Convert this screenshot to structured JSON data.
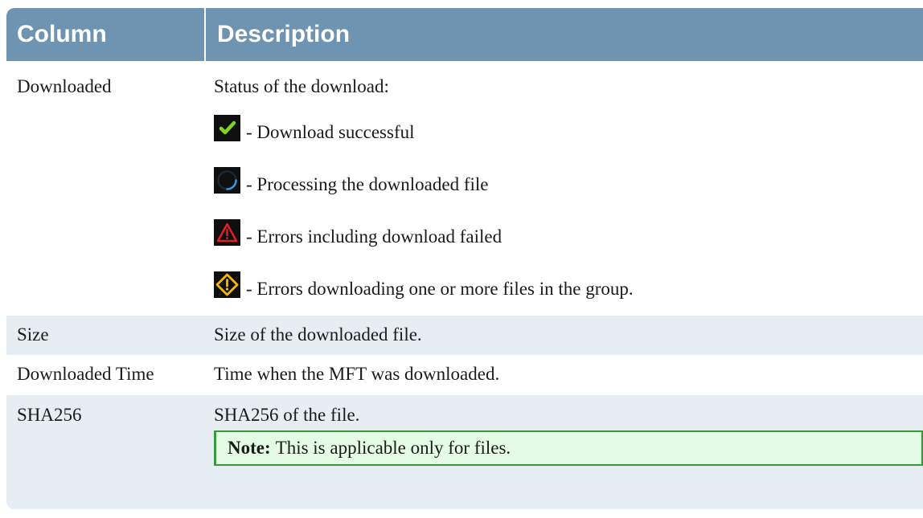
{
  "headers": {
    "column": "Column",
    "description": "Description"
  },
  "rows": {
    "downloaded": {
      "name": "Downloaded",
      "intro": "Status of the download:",
      "statuses": [
        {
          "icon": "check-icon",
          "text": "- Download successful"
        },
        {
          "icon": "spinner-icon",
          "text": "- Processing the downloaded file"
        },
        {
          "icon": "error-triangle-icon",
          "text": "- Errors including download failed"
        },
        {
          "icon": "warning-diamond-icon",
          "text": "- Errors downloading one or more files in the group."
        }
      ]
    },
    "size": {
      "name": "Size",
      "desc": "Size of the downloaded file."
    },
    "downloaded_time": {
      "name": "Downloaded Time",
      "desc": "Time when the MFT was downloaded."
    },
    "sha256": {
      "name": "SHA256",
      "desc": "SHA256 of the file.",
      "note_label": "Note:",
      "note_text": "This is applicable only for files."
    }
  },
  "colors": {
    "header_bg": "#6e94b1",
    "row_alt_bg": "#e6eef4",
    "note_bg": "#e4fce4",
    "note_border": "#3a9a3a"
  }
}
